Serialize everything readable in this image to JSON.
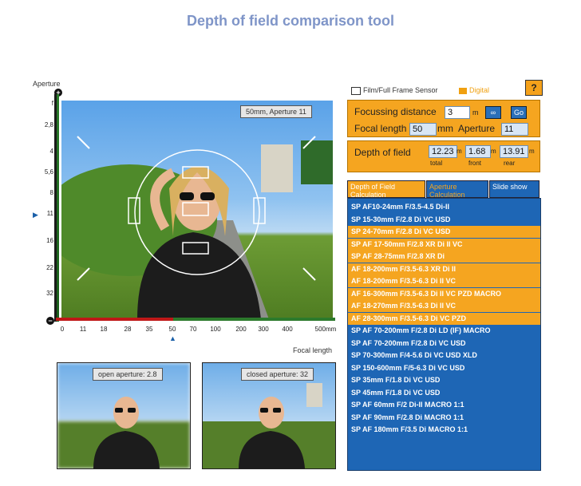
{
  "title": "Depth of field comparison tool",
  "aperture_scale": {
    "label": "Aperture",
    "ticks": [
      "f",
      "2,8",
      "4",
      "5,6",
      "8",
      "11",
      "16",
      "22",
      "32"
    ],
    "plus": "+",
    "minus": "−"
  },
  "main_photo": {
    "label": "50mm, Aperture 11"
  },
  "focal_scale": {
    "label": "Focal length",
    "ticks": [
      "0",
      "11",
      "18",
      "28",
      "35",
      "50",
      "70",
      "100",
      "200",
      "300",
      "400",
      "500mm"
    ]
  },
  "thumbnails": {
    "open_label": "open aperture: 2.8",
    "closed_label": "closed aperture: 32"
  },
  "sensor": {
    "film_label": "Film/Full Frame Sensor",
    "digital_label": "Digital"
  },
  "help_label": "?",
  "settings": {
    "focus_label": "Focussing distance",
    "focus_value": "3",
    "focus_unit": "m",
    "infinity_label": "∞",
    "go_label": "Go",
    "focal_label": "Focal length",
    "focal_value": "50",
    "focal_unit": "mm",
    "aperture_label": "Aperture",
    "aperture_value": "11"
  },
  "dof": {
    "label": "Depth of field",
    "total_value": "12.23",
    "total_label": "total",
    "front_value": "1.68",
    "front_label": "front",
    "rear_value": "13.91",
    "rear_label": "rear",
    "unit": "m"
  },
  "tabs": [
    {
      "label": "Depth of Field Calculation"
    },
    {
      "label": "Aperture Calculation"
    },
    {
      "label": "Slide show"
    }
  ],
  "lenses": [
    {
      "label": "SP AF10-24mm F/3.5-4.5 Di-II",
      "color": "blue"
    },
    {
      "label": "SP 15-30mm F/2.8 Di VC USD",
      "color": "blue"
    },
    {
      "label": "SP 24-70mm F/2.8 Di VC USD",
      "color": "orange"
    },
    {
      "label": "SP AF 17-50mm F/2.8 XR Di II VC",
      "color": "orange"
    },
    {
      "label": "SP AF 28-75mm F/2.8 XR Di",
      "color": "orange"
    },
    {
      "label": "AF 18-200mm F/3.5-6.3 XR Di II",
      "color": "orange"
    },
    {
      "label": "AF 18-200mm F/3.5-6.3 Di II VC",
      "color": "orange"
    },
    {
      "label": "AF 16-300mm F/3.5-6.3 Di II VC PZD MACRO",
      "color": "orange"
    },
    {
      "label": "AF 18-270mm F/3.5-6.3 Di II VC",
      "color": "orange"
    },
    {
      "label": "AF 28-300mm F/3.5-6.3 Di VC PZD",
      "color": "orange"
    },
    {
      "label": "SP AF 70-200mm F/2.8 Di LD (IF) MACRO",
      "color": "blue"
    },
    {
      "label": "SP AF 70-200mm F/2.8 Di VC USD",
      "color": "blue"
    },
    {
      "label": "SP 70-300mm F/4-5.6 Di VC USD XLD",
      "color": "blue"
    },
    {
      "label": "SP 150-600mm F/5-6.3 Di VC USD",
      "color": "blue"
    },
    {
      "label": "SP 35mm F/1.8 Di VC USD",
      "color": "blue"
    },
    {
      "label": "SP 45mm F/1.8 Di VC USD",
      "color": "blue"
    },
    {
      "label": "SP AF 60mm F/2 Di-II  MACRO 1:1",
      "color": "blue"
    },
    {
      "label": "SP AF 90mm F/2.8 Di    MACRO 1:1",
      "color": "blue"
    },
    {
      "label": "SP AF 180mm F/3.5 Di MACRO 1:1",
      "color": "blue"
    }
  ]
}
